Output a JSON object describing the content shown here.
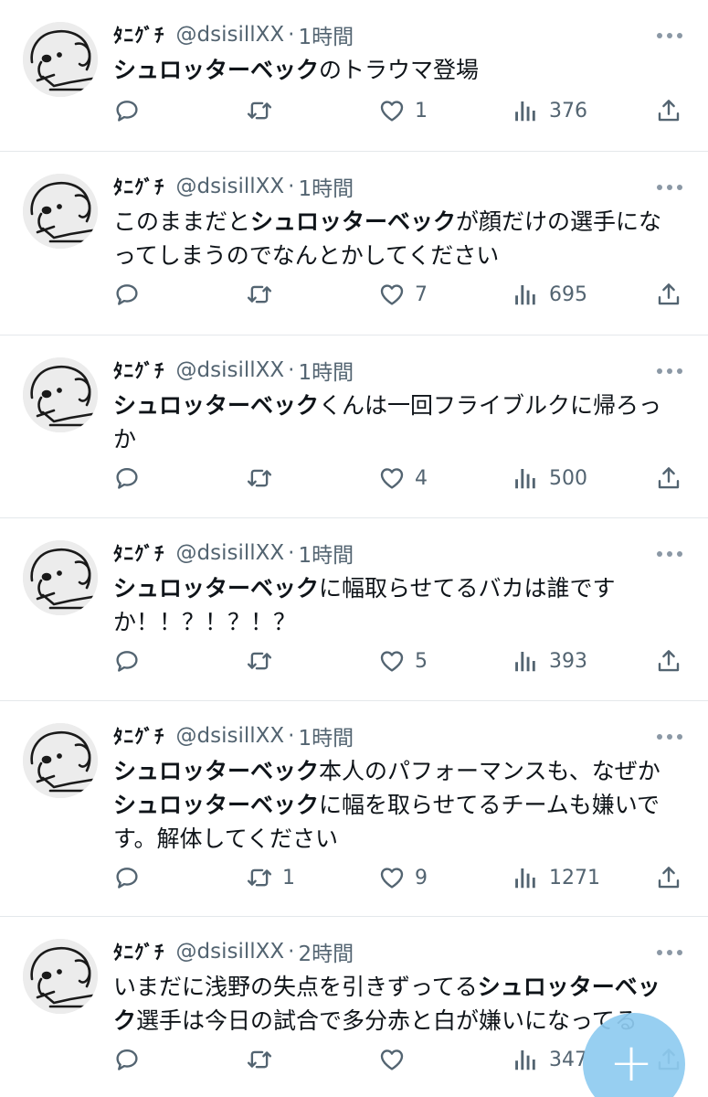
{
  "tweets": [
    {
      "username": "ﾀﾆｸﾞﾁ",
      "handle": "@dsisillXX",
      "time": "1時間",
      "lines": [
        [
          {
            "t": "シュロッターベック",
            "b": true
          },
          {
            "t": "のトラウマ登場",
            "b": false
          }
        ]
      ],
      "replies": "",
      "retweets": "",
      "likes": "1",
      "views": "376"
    },
    {
      "username": "ﾀﾆｸﾞﾁ",
      "handle": "@dsisillXX",
      "time": "1時間",
      "lines": [
        [
          {
            "t": "このままだと",
            "b": false
          },
          {
            "t": "シュロッターベック",
            "b": true
          },
          {
            "t": "が顔だけの選手にな",
            "b": false
          }
        ],
        [
          {
            "t": "ってしまうのでなんとかしてください",
            "b": false
          }
        ]
      ],
      "replies": "",
      "retweets": "",
      "likes": "7",
      "views": "695"
    },
    {
      "username": "ﾀﾆｸﾞﾁ",
      "handle": "@dsisillXX",
      "time": "1時間",
      "lines": [
        [
          {
            "t": "シュロッターベック",
            "b": true
          },
          {
            "t": "くんは一回フライブルクに帰ろっ",
            "b": false
          }
        ],
        [
          {
            "t": "か",
            "b": false
          }
        ]
      ],
      "replies": "",
      "retweets": "",
      "likes": "4",
      "views": "500"
    },
    {
      "username": "ﾀﾆｸﾞﾁ",
      "handle": "@dsisillXX",
      "time": "1時間",
      "lines": [
        [
          {
            "t": "シュロッターベック",
            "b": true
          },
          {
            "t": "に幅取らせてるバカは誰です",
            "b": false
          }
        ],
        [
          {
            "t": "か！！？！？！？",
            "b": false
          }
        ]
      ],
      "replies": "",
      "retweets": "",
      "likes": "5",
      "views": "393"
    },
    {
      "username": "ﾀﾆｸﾞﾁ",
      "handle": "@dsisillXX",
      "time": "1時間",
      "lines": [
        [
          {
            "t": "シュロッターベック",
            "b": true
          },
          {
            "t": "本人のパフォーマンスも、なぜか",
            "b": false
          }
        ],
        [
          {
            "t": "シュロッターベック",
            "b": true
          },
          {
            "t": "に幅を取らせてるチームも嫌いで",
            "b": false
          }
        ],
        [
          {
            "t": "す。解体してください",
            "b": false
          }
        ]
      ],
      "replies": "",
      "retweets": "1",
      "likes": "9",
      "views": "1271"
    },
    {
      "username": "ﾀﾆｸﾞﾁ",
      "handle": "@dsisillXX",
      "time": "2時間",
      "lines": [
        [
          {
            "t": "いまだに浅野の失点を引きずってる",
            "b": false
          },
          {
            "t": "シュロッターベッ",
            "b": true
          }
        ],
        [
          {
            "t": "ク",
            "b": true
          },
          {
            "t": "選手は今日の試合で多分赤と白が嫌いになってる",
            "b": false
          }
        ]
      ],
      "replies": "",
      "retweets": "",
      "likes": "",
      "views": "347"
    }
  ],
  "fab": {
    "label": "+",
    "icon": "compose-plus-icon"
  },
  "icons": {
    "reply": "reply-icon",
    "retweet": "retweet-icon",
    "like": "heart-icon",
    "views": "views-icon",
    "share": "share-icon",
    "more": "more-icon",
    "avatar": "dog-drawing-avatar"
  },
  "colors": {
    "text": "#0f1419",
    "secondary": "#536471",
    "divider": "#e4e8eb",
    "fab": "#8ecbf0"
  }
}
